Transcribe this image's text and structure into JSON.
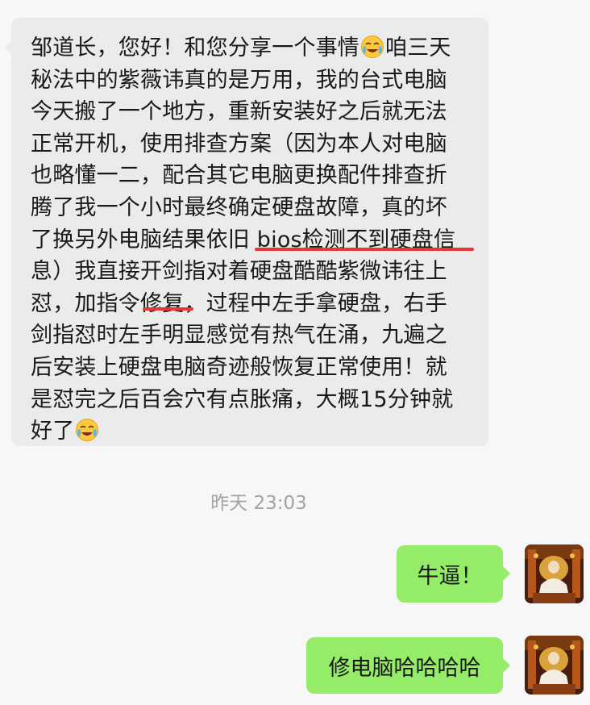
{
  "incoming_message": {
    "lines": [
      [
        "邹道长，您好！和您分享一个事情",
        "[emoji]",
        "咱三天"
      ],
      [
        "秘法中的紫薇讳真的是万用，我的台式电脑"
      ],
      [
        "今天搬了一个地方，重新安装好之后就无法"
      ],
      [
        "正常开机，使用排查方案（因为本人对电脑"
      ],
      [
        "也略懂一二，配合其它电脑更换配件排查折"
      ],
      [
        "腾了我一个小时最终确定硬盘故障，真的坏"
      ],
      [
        "了换另外电脑结果依旧 bios检测不到硬盘信"
      ],
      [
        "息）我直接开剑指对着硬盘酷酷紫微讳往上"
      ],
      [
        "怼，加指令修复，过程中左手拿硬盘，右手"
      ],
      [
        "剑指怼时左手明显感觉有热气在涌，九遍之"
      ],
      [
        "后安装上硬盘电脑奇迹般恢复正常使用！就"
      ],
      [
        "是怼完之后百会穴有点胀痛，大概15分钟就"
      ],
      [
        "好了",
        "[emoji]"
      ]
    ],
    "emoji_name": "face-with-tears-emoji"
  },
  "timestamp": "昨天 23:03",
  "outgoing_messages": [
    {
      "text": "牛逼！"
    },
    {
      "text": "修电脑哈哈哈哈"
    }
  ],
  "colors": {
    "background": "#f7f7f7",
    "incoming_bubble": "#ebebeb",
    "outgoing_bubble": "#95ec69",
    "underline": "#e53935",
    "timestamp_text": "#a3a3a3"
  }
}
